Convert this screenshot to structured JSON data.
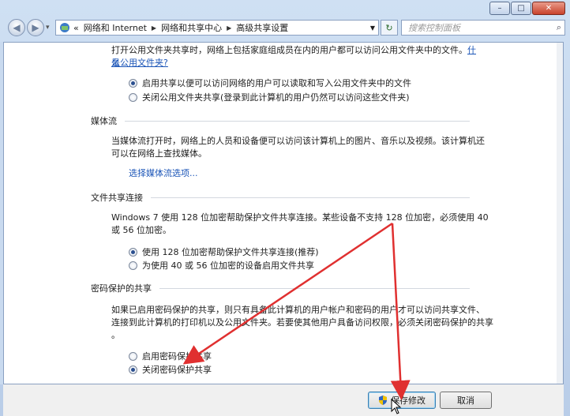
{
  "window": {
    "minimize_glyph": "–",
    "maximize_glyph": "□",
    "close_glyph": "✕"
  },
  "nav": {
    "back_glyph": "◀",
    "forward_glyph": "▶",
    "history_glyph": "▾",
    "breadcrumb_lead": "«",
    "breadcrumbs": [
      "网络和 Internet",
      "网络和共享中心",
      "高级共享设置"
    ],
    "refresh_glyph": "↻",
    "search_placeholder": "搜索控制面板",
    "search_icon": "search-icon"
  },
  "public_folder": {
    "description": "打开公用文件夹共享时，网络上包括家庭组成员在内的用户都可以访问公用文件夹中的文件。",
    "link_part1": "什么",
    "link_part2": "是公用文件夹?",
    "options": [
      {
        "label": "启用共享以便可以访问网络的用户可以读取和写入公用文件夹中的文件",
        "checked": true
      },
      {
        "label": "关闭公用文件夹共享(登录到此计算机的用户仍然可以访问这些文件夹)",
        "checked": false
      }
    ]
  },
  "media": {
    "title": "媒体流",
    "desc_line1": "当媒体流打开时，网络上的人员和设备便可以访问该计算机上的图片、音乐以及视频。该计算机还",
    "desc_line2": "可以在网络上查找媒体。",
    "link": "选择媒体流选项..."
  },
  "file_sharing": {
    "title": "文件共享连接",
    "desc_line1": "Windows 7 使用 128 位加密帮助保护文件共享连接。某些设备不支持 128 位加密，必须使用 40",
    "desc_line2": "或 56 位加密。",
    "options": [
      {
        "label": "使用 128 位加密帮助保护文件共享连接(推荐)",
        "checked": true
      },
      {
        "label": "为使用 40 或 56 位加密的设备启用文件共享",
        "checked": false
      }
    ]
  },
  "password": {
    "title": "密码保护的共享",
    "desc_line1": "如果已启用密码保护的共享，则只有具备此计算机的用户帐户和密码的用户才可以访问共享文件、",
    "desc_line2": "连接到此计算机的打印机以及公用文件夹。若要使其他用户具备访问权限，必须关闭密码保护的共享",
    "desc_line3": "。",
    "options": [
      {
        "label": "启用密码保护共享",
        "checked": false
      },
      {
        "label": "关闭密码保护共享",
        "checked": true
      }
    ]
  },
  "footer": {
    "save_label": "保存修改",
    "cancel_label": "取消"
  },
  "colors": {
    "accent_link": "#1a54b7",
    "annotation_arrow": "#e03030"
  }
}
